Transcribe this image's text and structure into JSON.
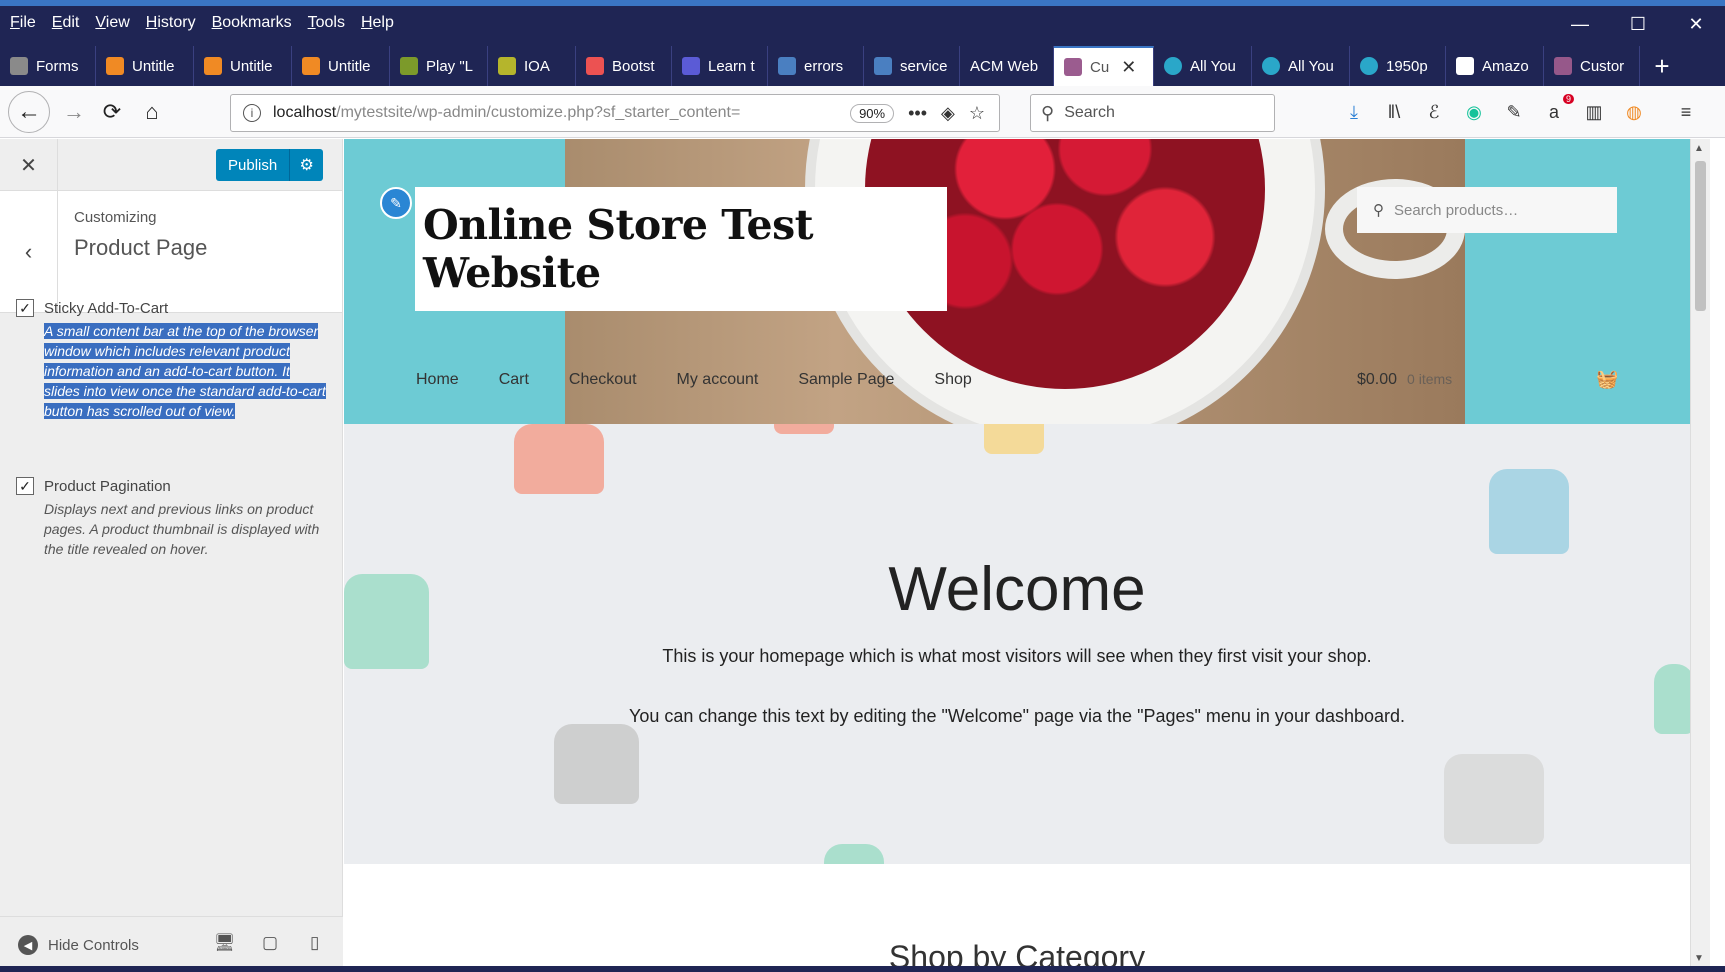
{
  "menubar": {
    "items": [
      "File",
      "Edit",
      "View",
      "History",
      "Bookmarks",
      "Tools",
      "Help"
    ]
  },
  "window_controls": {
    "minimize": "—",
    "maximize": "☐",
    "close": "✕"
  },
  "tabs": [
    {
      "label": "Forms",
      "icon": "form-icon",
      "color": "#8a8a8a"
    },
    {
      "label": "Untitle",
      "icon": "stackblitz-icon",
      "color": "#f08a24"
    },
    {
      "label": "Untitle",
      "icon": "stackblitz-icon",
      "color": "#f08a24"
    },
    {
      "label": "Untitle",
      "icon": "stackblitz-icon",
      "color": "#f08a24"
    },
    {
      "label": "Play \"L",
      "icon": "folder-icon",
      "color": "#7c9a2a"
    },
    {
      "label": "IOA",
      "icon": "ioa-icon",
      "color": "#b5b52c"
    },
    {
      "label": "Bootst",
      "icon": "udemy-icon",
      "color": "#ec5252"
    },
    {
      "label": "Learn t",
      "icon": "learn-icon",
      "color": "#5b5bd6"
    },
    {
      "label": "errors",
      "icon": "globe-icon",
      "color": "#4a7fc1"
    },
    {
      "label": "service",
      "icon": "globe-icon",
      "color": "#4a7fc1"
    },
    {
      "label": "ACM Web",
      "icon": "",
      "color": ""
    },
    {
      "label": "Cu",
      "icon": "woo-icon",
      "color": "#9b5c8f",
      "active": true
    },
    {
      "label": "All You",
      "icon": "c-icon",
      "color": "#2aa7c9"
    },
    {
      "label": "All You",
      "icon": "c-icon",
      "color": "#2aa7c9"
    },
    {
      "label": "1950p",
      "icon": "c-icon",
      "color": "#2aa7c9"
    },
    {
      "label": "Amazo",
      "icon": "amazon-icon",
      "color": "#ffffff"
    },
    {
      "label": "Custor",
      "icon": "w-icon",
      "color": "#96588a"
    }
  ],
  "tab_close": "✕",
  "tab_new": "+",
  "navbar": {
    "back": "←",
    "forward": "→",
    "reload": "⟳",
    "home": "⌂",
    "url_host": "localhost",
    "url_path": "/mytestsite/wp-admin/customize.php?sf_starter_content=",
    "zoom": "90%",
    "more": "•••",
    "search_placeholder": "Search"
  },
  "toolbar_badges": {
    "amazon_count": "9"
  },
  "sidebar": {
    "close": "✕",
    "publish_label": "Publish",
    "back": "‹",
    "crumb": "Customizing",
    "title": "Product Page",
    "options": [
      {
        "label": "Sticky Add-To-Cart",
        "checked": true,
        "description": "A small content bar at the top of the browser window which includes relevant product information and an add-to-cart button. It slides into view once the standard add-to-cart button has scrolled out of view.",
        "selected_text": true
      },
      {
        "label": "Product Pagination",
        "checked": true,
        "description": "Displays next and previous links on product pages. A product thumbnail is displayed with the title revealed on hover.",
        "selected_text": false
      }
    ],
    "hide_controls": "Hide Controls"
  },
  "preview": {
    "site_title": "Online Store Test Website",
    "search_placeholder": "Search products…",
    "nav": [
      "Home",
      "Cart",
      "Checkout",
      "My account",
      "Sample Page",
      "Shop"
    ],
    "cart_total": "$0.00",
    "cart_count": "0 items",
    "welcome_title": "Welcome",
    "welcome_p1": "This is your homepage which is what most visitors will see when they first visit your shop.",
    "welcome_p2": "You can change this text by editing the \"Welcome\" page via the \"Pages\" menu in your dashboard.",
    "shop_by_category": "Shop by Category"
  },
  "colors": {
    "chrome": "#1f2554",
    "accent": "#3a75c4",
    "publish": "#0085ba",
    "hero_bg": "#6dcbd4",
    "selection": "#3a6ec0"
  }
}
